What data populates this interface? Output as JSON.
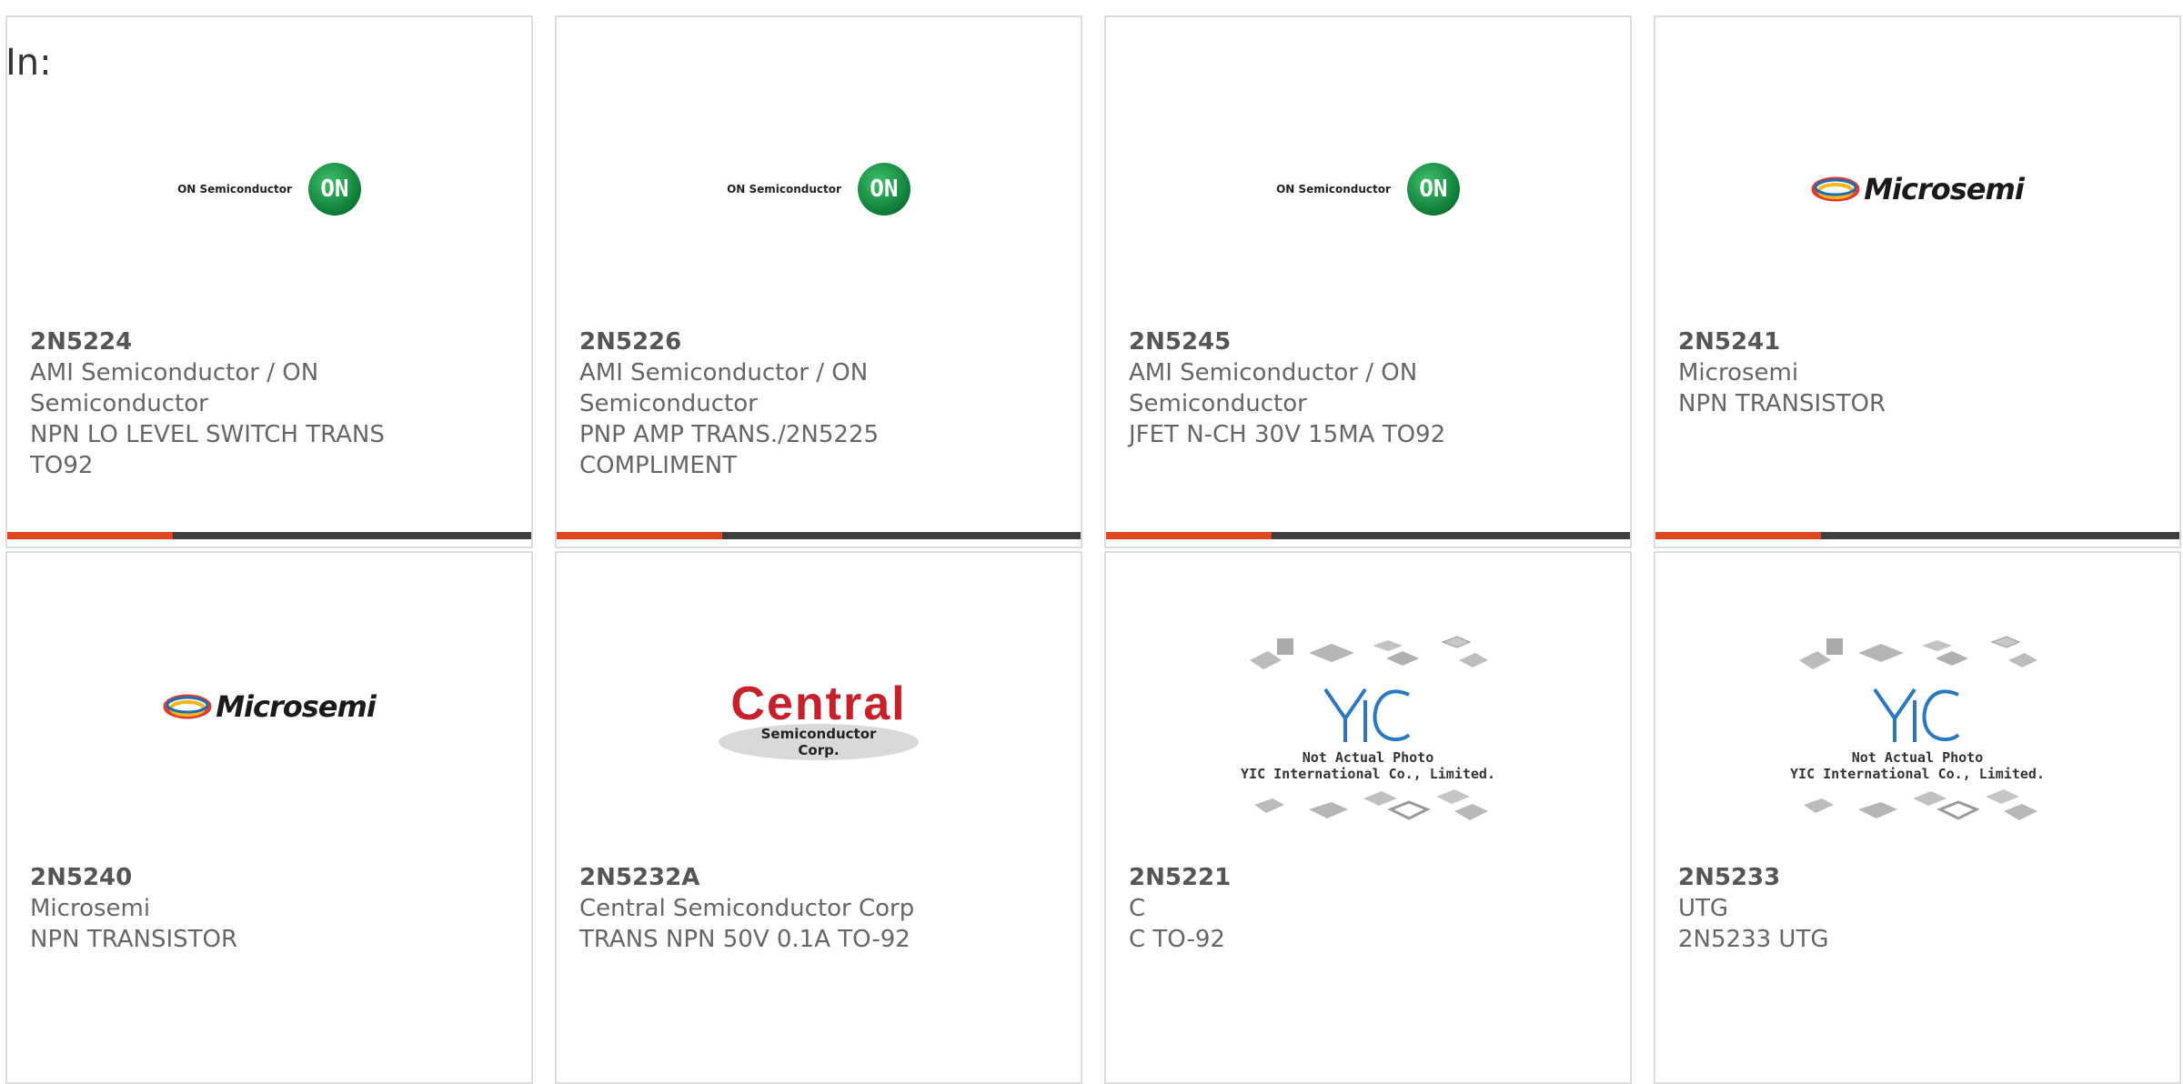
{
  "filter": {
    "label": "In:"
  },
  "colors": {
    "accent": "#e0451b",
    "bar": "#404040",
    "border": "#dcdcdc",
    "text": "#666666"
  },
  "products": [
    {
      "part": "2N5224",
      "manufacturer": "AMI Semiconductor / ON Semiconductor",
      "description": "NPN LO LEVEL SWITCH TRANS TO92",
      "logo": "on-semiconductor",
      "logo_text": "ON Semiconductor",
      "logo_mark": "ON"
    },
    {
      "part": "2N5226",
      "manufacturer": "AMI Semiconductor / ON Semiconductor",
      "description": "PNP AMP TRANS./2N5225 COMPLIMENT",
      "logo": "on-semiconductor",
      "logo_text": "ON Semiconductor",
      "logo_mark": "ON"
    },
    {
      "part": "2N5245",
      "manufacturer": "AMI Semiconductor / ON Semiconductor",
      "description": "JFET N-CH 30V 15MA TO92",
      "logo": "on-semiconductor",
      "logo_text": "ON Semiconductor",
      "logo_mark": "ON"
    },
    {
      "part": "2N5241",
      "manufacturer": "Microsemi",
      "description": "NPN TRANSISTOR",
      "logo": "microsemi",
      "logo_text": "Microsemi"
    },
    {
      "part": "2N5240",
      "manufacturer": "Microsemi",
      "description": "NPN TRANSISTOR",
      "logo": "microsemi",
      "logo_text": "Microsemi"
    },
    {
      "part": "2N5232A",
      "manufacturer": "Central Semiconductor Corp",
      "description": "TRANS NPN 50V 0.1A TO-92",
      "logo": "central",
      "logo_text": "Central",
      "logo_sub": "Semiconductor Corp."
    },
    {
      "part": "2N5221",
      "manufacturer": "C",
      "description": "C TO-92",
      "logo": "yic-placeholder",
      "logo_text": "YIC",
      "logo_sub": "Not Actual Photo",
      "logo_sub2": "YIC International Co., Limited."
    },
    {
      "part": "2N5233",
      "manufacturer": "UTG",
      "description": "2N5233 UTG",
      "logo": "yic-placeholder",
      "logo_text": "YIC",
      "logo_sub": "Not Actual Photo",
      "logo_sub2": "YIC International Co., Limited."
    }
  ]
}
